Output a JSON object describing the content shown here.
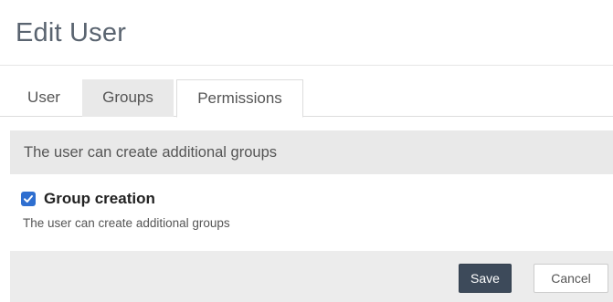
{
  "dialog": {
    "title": "Edit User"
  },
  "tabs": [
    {
      "label": "User",
      "active": false
    },
    {
      "label": "Groups",
      "active": false
    },
    {
      "label": "Permissions",
      "active": true
    }
  ],
  "permissions": {
    "section_text": "The user can create additional groups",
    "items": [
      {
        "label": "Group creation",
        "description": "The user can create additional groups",
        "checked": true
      }
    ]
  },
  "footer": {
    "save_label": "Save",
    "cancel_label": "Cancel"
  },
  "colors": {
    "accent": "#2f6fd0",
    "primary_button": "#3d4a5a"
  }
}
